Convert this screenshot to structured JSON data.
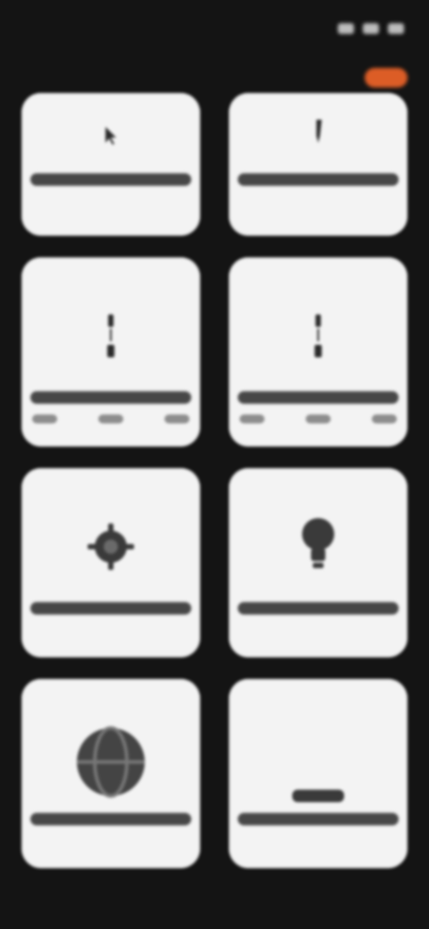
{
  "status_bar": {
    "time": "",
    "icons": [
      "signal-icon",
      "wifi-icon",
      "battery-icon"
    ]
  },
  "header": {
    "title": "",
    "accent_color": "#ff6a2a"
  },
  "tiles": [
    {
      "label": "",
      "icon": "cursor-icon"
    },
    {
      "label": "",
      "icon": "pen-icon"
    },
    {
      "label": "",
      "icon": "connector-icon"
    },
    {
      "label": "",
      "icon": "connector-icon"
    },
    {
      "label": "",
      "icon": "cog-icon"
    },
    {
      "label": "",
      "icon": "lightbulb-icon"
    },
    {
      "label": "",
      "icon": "globe-icon"
    },
    {
      "label": "",
      "icon": "shape-icon"
    }
  ],
  "colors": {
    "background": "#141414",
    "tile": "#f3f3f3",
    "tile_text": "#2a2a2a"
  }
}
